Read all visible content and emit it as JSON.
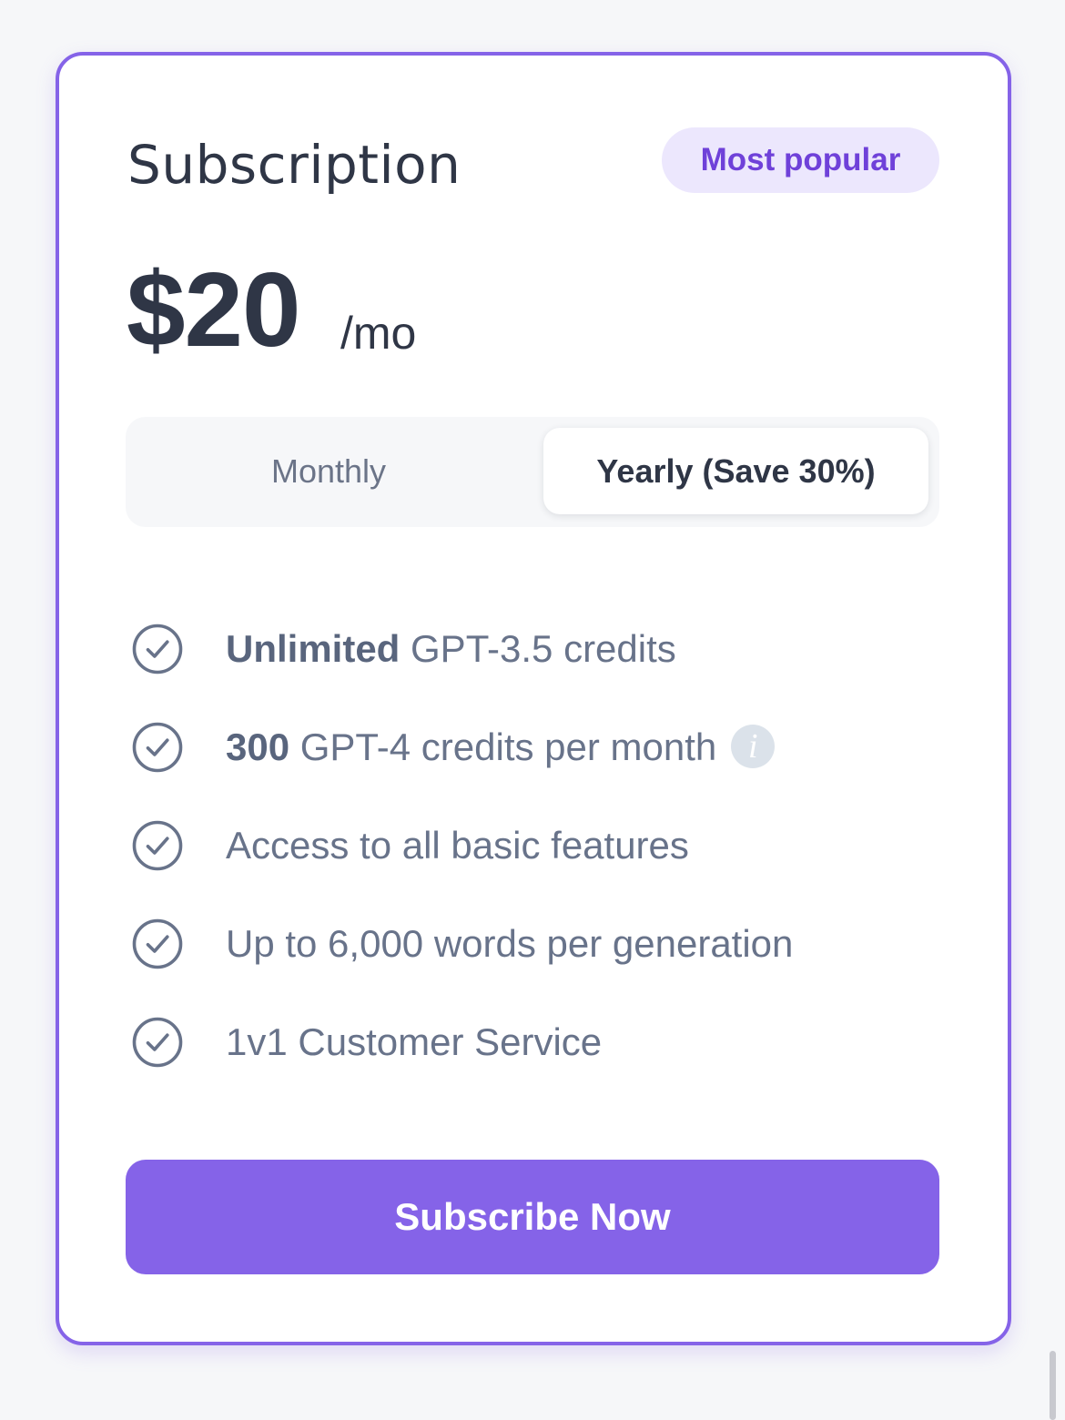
{
  "plan": {
    "title": "Subscription",
    "badge": "Most popular",
    "price": "$20",
    "price_unit": "/mo"
  },
  "billing_toggle": {
    "options": [
      {
        "label": "Monthly",
        "selected": false
      },
      {
        "label": "Yearly (Save 30%)",
        "selected": true
      }
    ]
  },
  "features": [
    {
      "highlight": "Unlimited",
      "text": " GPT-3.5 credits",
      "icon": "check-circle-icon"
    },
    {
      "highlight": "300",
      "text": " GPT-4 credits per month",
      "icon": "check-circle-icon",
      "info_icon": "i"
    },
    {
      "highlight": "",
      "text": "Access to all basic features",
      "icon": "check-circle-icon"
    },
    {
      "highlight": "",
      "text": "Up to 6,000 words per generation",
      "icon": "check-circle-icon"
    },
    {
      "highlight": "",
      "text": "1v1 Customer Service",
      "icon": "check-circle-icon"
    }
  ],
  "cta": {
    "label": "Subscribe Now"
  },
  "colors": {
    "accent": "#8563e8",
    "badge_bg": "#ece7fd",
    "badge_text": "#6f41d9",
    "heading": "#2f3646",
    "muted": "#68738a"
  }
}
